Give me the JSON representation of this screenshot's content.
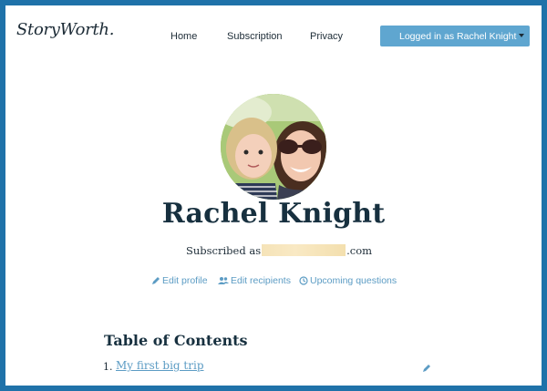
{
  "header": {
    "logo": "StoryWorth.",
    "nav": [
      "Home",
      "Subscription",
      "Privacy"
    ],
    "account_button": "Logged in as Rachel Knight"
  },
  "profile": {
    "name": "Rachel Knight",
    "subscribed_prefix": "Subscribed as",
    "subscribed_suffix": ".com",
    "avatar_icon": "profile-photo"
  },
  "actions": [
    {
      "label": "Edit profile",
      "icon": "pencil-icon"
    },
    {
      "label": "Edit recipients",
      "icon": "users-icon"
    },
    {
      "label": "Upcoming questions",
      "icon": "clock-icon"
    }
  ],
  "toc": {
    "title": "Table of Contents",
    "items": [
      {
        "number": "1.",
        "title": "My first big trip"
      }
    ]
  },
  "colors": {
    "frame": "#1f72a9",
    "button": "#5fa6d0",
    "link": "#5c9cc4",
    "heading": "#17303f"
  }
}
